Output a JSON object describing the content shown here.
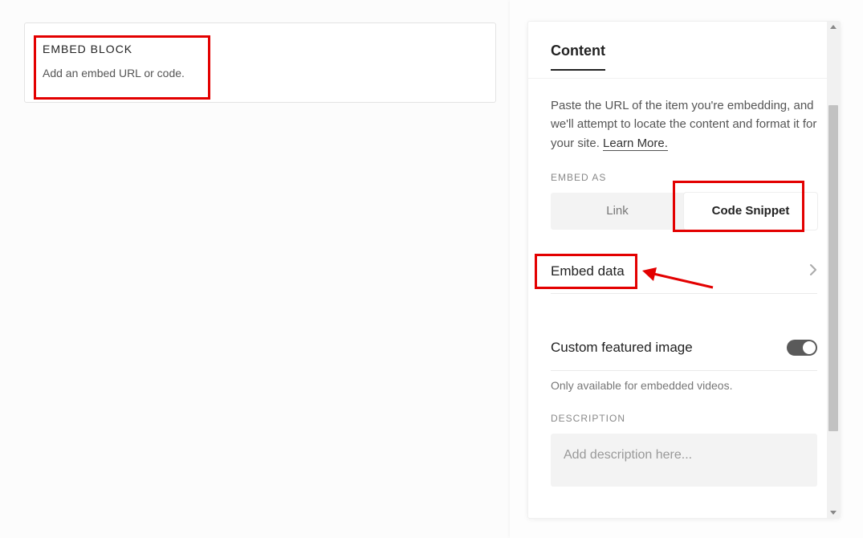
{
  "embed_block": {
    "title": "EMBED BLOCK",
    "subtitle": "Add an embed URL or code."
  },
  "panel": {
    "tab": "Content",
    "info_text_prefix": "Paste the URL of the item you're embedding, and we'll attempt to locate the content and format it for your site. ",
    "learn_more": "Learn More.",
    "embed_as_label": "EMBED AS",
    "segmented": {
      "link": "Link",
      "code": "Code Snippet"
    },
    "embed_data_label": "Embed data",
    "featured_image_label": "Custom featured image",
    "featured_image_helper": "Only available for embedded videos.",
    "description_label": "DESCRIPTION",
    "description_placeholder": "Add description here..."
  }
}
